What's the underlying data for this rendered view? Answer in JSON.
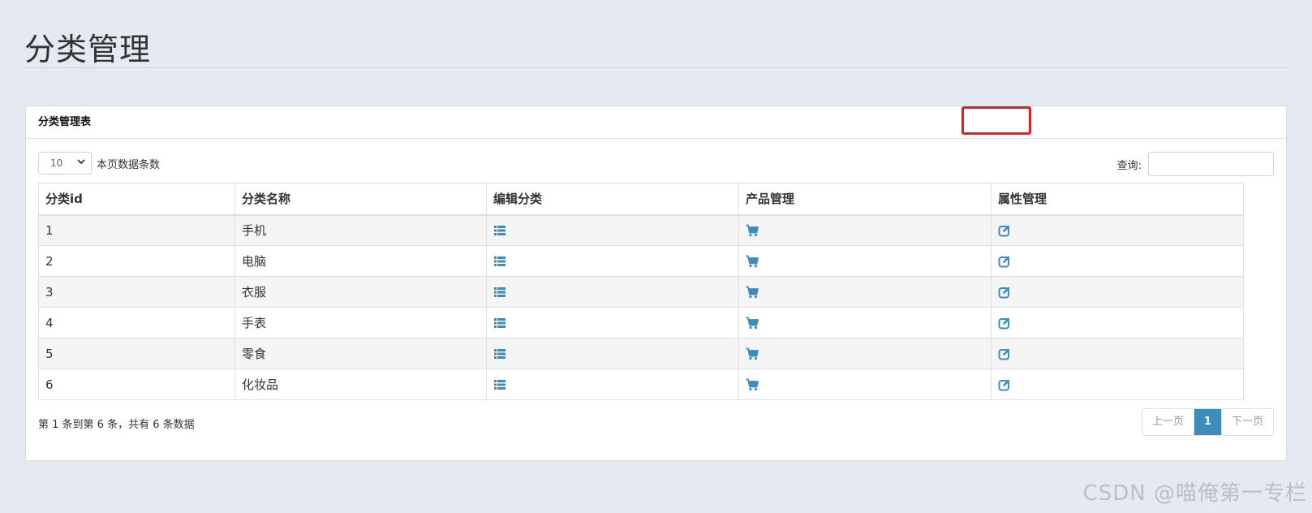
{
  "page_title": "分类管理",
  "panel_title": "分类管理表",
  "page_size": {
    "value": "10",
    "label": "本页数据条数"
  },
  "search": {
    "label": "查询:",
    "value": ""
  },
  "table": {
    "headers": [
      "分类id",
      "分类名称",
      "编辑分类",
      "产品管理",
      "属性管理"
    ],
    "rows": [
      {
        "id": "1",
        "name": "手机"
      },
      {
        "id": "2",
        "name": "电脑"
      },
      {
        "id": "3",
        "name": "衣服"
      },
      {
        "id": "4",
        "name": "手表"
      },
      {
        "id": "5",
        "name": "零食"
      },
      {
        "id": "6",
        "name": "化妆品"
      }
    ],
    "icons": {
      "edit": "list-icon",
      "products": "cart-icon",
      "properties": "edit-icon"
    }
  },
  "info_text": "第 1 条到第 6 条，共有 6 条数据",
  "pager": {
    "prev": "上一页",
    "current": "1",
    "next": "下一页"
  },
  "watermark": "CSDN @喵俺第一专栏",
  "colors": {
    "accent": "#3c8dbc",
    "highlight": "#e0201a",
    "background": "#e5eaf2"
  }
}
